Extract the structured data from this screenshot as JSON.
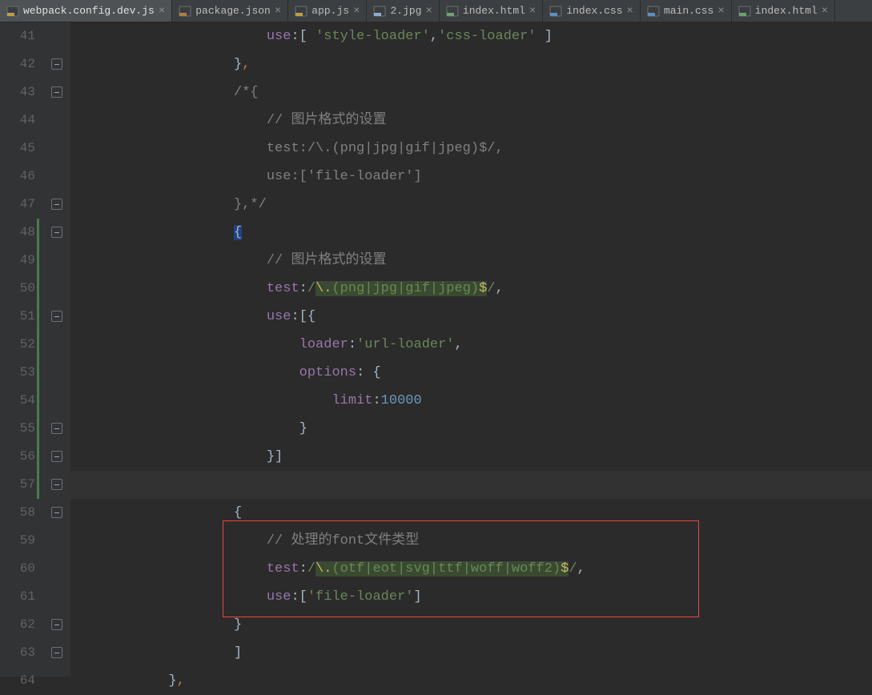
{
  "tabs": [
    {
      "label": "webpack.config.dev.js",
      "icon": "js",
      "active": true
    },
    {
      "label": "package.json",
      "icon": "json",
      "active": false
    },
    {
      "label": "app.js",
      "icon": "js",
      "active": false
    },
    {
      "label": "2.jpg",
      "icon": "img",
      "active": false
    },
    {
      "label": "index.html",
      "icon": "html",
      "active": false
    },
    {
      "label": "index.css",
      "icon": "css",
      "active": false
    },
    {
      "label": "main.css",
      "icon": "css",
      "active": false
    },
    {
      "label": "index.html",
      "icon": "html",
      "active": false
    }
  ],
  "lineStart": 41,
  "lineEnd": 64,
  "code": {
    "l41": {
      "indent": "                        ",
      "prop": "use",
      "after": ":[ 'style-loader','css-loader' ]"
    },
    "l42": {
      "text": "                    },"
    },
    "l43": {
      "text": "                    /*{"
    },
    "l44": {
      "text": "                        // 图片格式的设置"
    },
    "l45": {
      "text": "                        test:/\\.(png|jpg|gif|jpeg)$/,"
    },
    "l46": {
      "text": "                        use:['file-loader']"
    },
    "l47": {
      "text": "                    },*/"
    },
    "l48": {
      "text": "                    {"
    },
    "l49": {
      "comment": "                        // 图片格式的设置"
    },
    "l50": {
      "indent": "                        ",
      "prop": "test",
      "regex1": "/",
      "regex2": "\\.",
      "group": "(png|jpg|gif|jpeg)",
      "end": "$",
      "close": "/",
      "comma": ","
    },
    "l51": {
      "indent": "                        ",
      "prop": "use",
      "after": ":[{"
    },
    "l52": {
      "indent": "                            ",
      "prop": "loader",
      "after": ":",
      "str": "'url-loader'",
      "comma": ","
    },
    "l53": {
      "indent": "                            ",
      "prop": "options",
      "after": ": {"
    },
    "l54": {
      "indent": "                                ",
      "prop": "limit",
      "after": ":",
      "num": "10000"
    },
    "l55": {
      "text": "                            }"
    },
    "l56": {
      "text": "                        }]"
    },
    "l57": {
      "text": "                    },"
    },
    "l58": {
      "text": "                    {"
    },
    "l59": {
      "comment": "                        // 处理的font文件类型"
    },
    "l60": {
      "indent": "                        ",
      "prop": "test",
      "regex1": "/",
      "regex2": "\\.",
      "group": "(otf|eot|svg|ttf|woff|woff2)",
      "end": "$",
      "close": "/",
      "comma": ","
    },
    "l61": {
      "indent": "                        ",
      "prop": "use",
      "after": ":[",
      "str": "'file-loader'",
      "close2": "]"
    },
    "l62": {
      "text": "                    }"
    },
    "l63": {
      "text": "                    ]"
    },
    "l64": {
      "text": "            },"
    }
  },
  "folds": [
    42,
    43,
    47,
    48,
    51,
    55,
    56,
    57,
    58,
    62,
    63
  ],
  "changeBar": {
    "from": 48,
    "to": 57
  },
  "caretLine": 57,
  "redBox": {
    "fromLine": 59,
    "toLine": 61
  }
}
